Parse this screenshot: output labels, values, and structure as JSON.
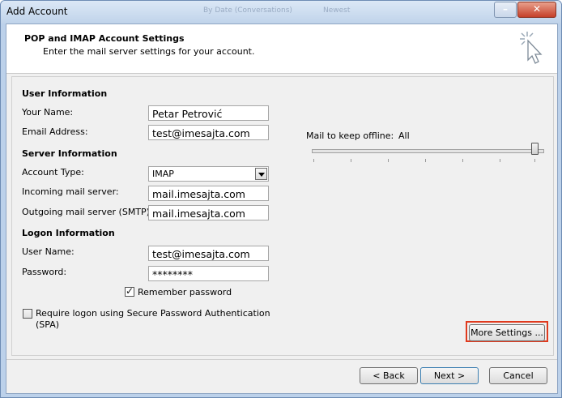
{
  "window": {
    "title": "Add Account",
    "background_text_1": "By Date (Conversations)",
    "background_text_2": "Newest"
  },
  "header": {
    "title": "POP and IMAP Account Settings",
    "subtitle": "Enter the mail server settings for your account."
  },
  "user_info": {
    "section": "User Information",
    "name_label": "Your Name:",
    "name_value": "Petar Petrović",
    "email_label": "Email Address:",
    "email_value": "test@imesajta.com"
  },
  "server_info": {
    "section": "Server Information",
    "account_type_label": "Account Type:",
    "account_type_value": "IMAP",
    "incoming_label": "Incoming mail server:",
    "incoming_value": "mail.imesajta.com",
    "outgoing_label": "Outgoing mail server (SMTP):",
    "outgoing_value": "mail.imesajta.com"
  },
  "logon_info": {
    "section": "Logon Information",
    "username_label": "User Name:",
    "username_value": "test@imesajta.com",
    "password_label": "Password:",
    "password_value": "********",
    "remember_label": "Remember password",
    "remember_checked": true,
    "spa_label_line1": "Require logon using Secure Password Authentication",
    "spa_label_line2": "(SPA)",
    "spa_checked": false
  },
  "offline": {
    "label": "Mail to keep offline:",
    "value": "All",
    "slider_level": 1.0
  },
  "buttons": {
    "more_settings": "More Settings ...",
    "back": "< Back",
    "next": "Next >",
    "cancel": "Cancel"
  },
  "colors": {
    "highlight": "#e03a1e",
    "title_bar": "#c0d3ea",
    "close_button": "#c5402a"
  }
}
